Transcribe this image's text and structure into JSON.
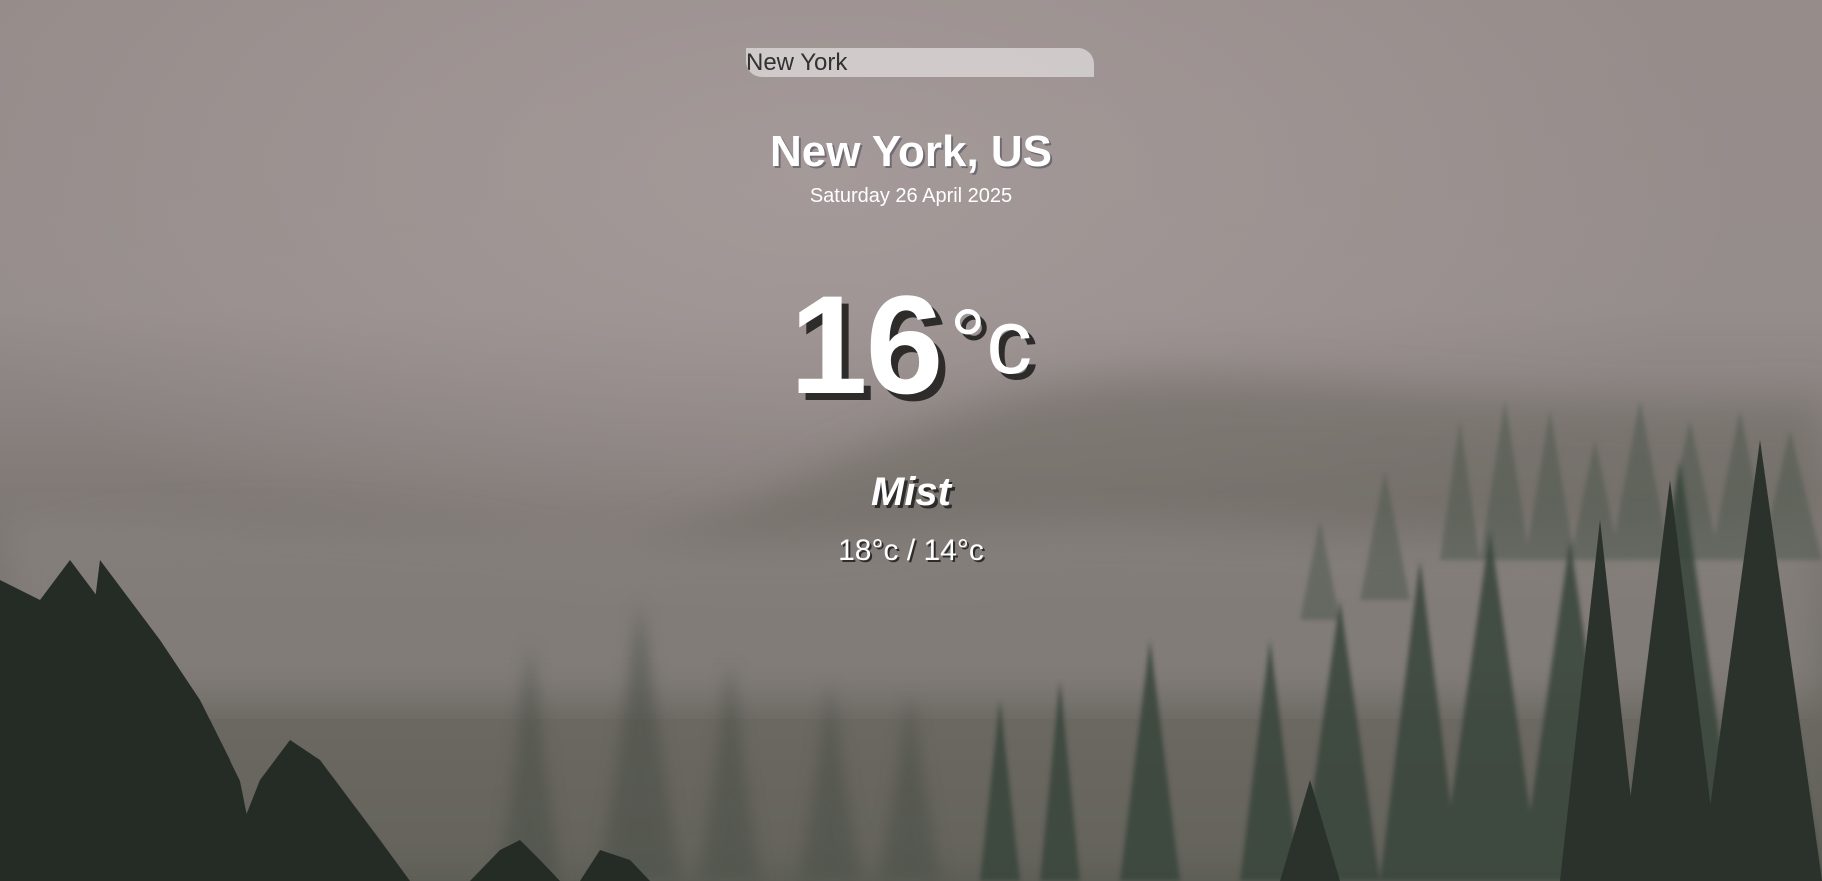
{
  "search": {
    "value": "New York"
  },
  "location": {
    "text": "New York, US"
  },
  "date": {
    "text": "Saturday 26 April 2025"
  },
  "current": {
    "temp": "16",
    "unit": "°c",
    "weather": "Mist",
    "hi_low": "18°c / 14°c"
  },
  "background": {
    "scene": "misty-forest",
    "sky_color": "#9a8f8e",
    "fog_color": "#8a8482",
    "tree_color": "#2e362e"
  }
}
